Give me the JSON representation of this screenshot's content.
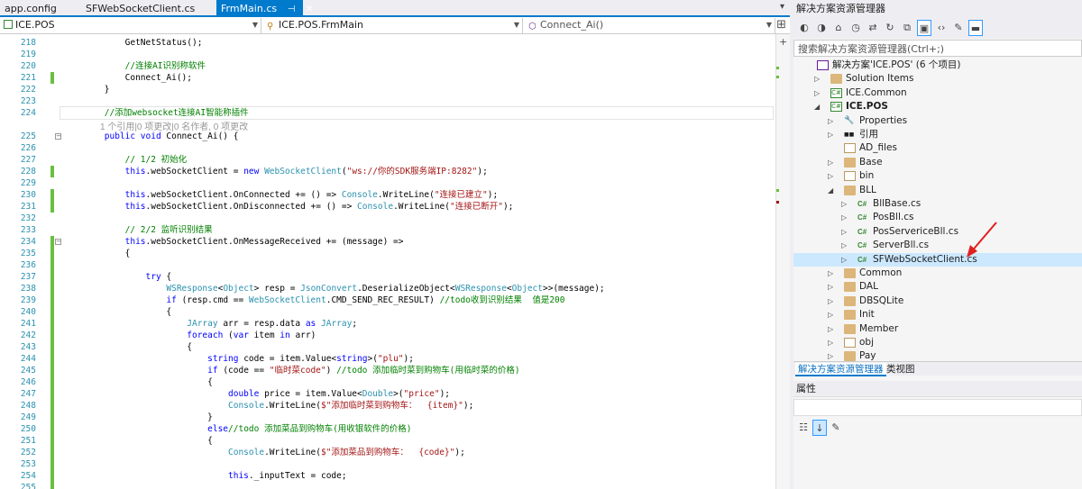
{
  "tabs": {
    "items": [
      {
        "label": "app.config"
      },
      {
        "label": "SFWebSocketClient.cs"
      },
      {
        "label": "FrmMain.cs",
        "active": true
      }
    ],
    "pin_icon": "pin-icon",
    "close_glyph": "✕",
    "dropdown_glyph": "▾"
  },
  "navbar": {
    "project": "ICE.POS",
    "class_name": "ICE.POS.FrmMain",
    "member": "Connect_Ai()"
  },
  "editor": {
    "codelens": "1 个引用|0 项更改|0 名作者, 0 项更改",
    "lines": [
      {
        "n": "218",
        "code": [
          [
            "pl",
            "            GetNetStatus();"
          ]
        ]
      },
      {
        "n": "219",
        "code": []
      },
      {
        "n": "220",
        "code": [
          [
            "cm",
            "            //连接AI识别称软件"
          ]
        ]
      },
      {
        "n": "221",
        "code": [
          [
            "pl",
            "            Connect_Ai();"
          ]
        ]
      },
      {
        "n": "222",
        "code": [
          [
            "pl",
            "        }"
          ]
        ]
      },
      {
        "n": "223",
        "code": []
      },
      {
        "n": "224",
        "code": [
          [
            "cm",
            "        //添加websocket连接AI智能称插件"
          ]
        ]
      },
      {
        "n": "225",
        "code": [
          [
            "kw",
            "        public void "
          ],
          [
            "pl",
            "Connect_Ai() {"
          ]
        ]
      },
      {
        "n": "226",
        "code": []
      },
      {
        "n": "227",
        "code": [
          [
            "cm",
            "            // 1/2 初始化"
          ]
        ]
      },
      {
        "n": "228",
        "code": [
          [
            "kw",
            "            this"
          ],
          [
            "pl",
            ".webSocketClient = "
          ],
          [
            "kw",
            "new "
          ],
          [
            "ty",
            "WebSocketClient"
          ],
          [
            "pl",
            "("
          ],
          [
            "st",
            "\"ws://你的SDK服务端IP:8282\""
          ],
          [
            "pl",
            ");"
          ]
        ]
      },
      {
        "n": "229",
        "code": []
      },
      {
        "n": "230",
        "code": [
          [
            "kw",
            "            this"
          ],
          [
            "pl",
            ".webSocketClient.OnConnected += () => "
          ],
          [
            "ty",
            "Console"
          ],
          [
            "pl",
            ".WriteLine("
          ],
          [
            "st",
            "\"连接已建立\""
          ],
          [
            "pl",
            ");"
          ]
        ]
      },
      {
        "n": "231",
        "code": [
          [
            "kw",
            "            this"
          ],
          [
            "pl",
            ".webSocketClient.OnDisconnected += () => "
          ],
          [
            "ty",
            "Console"
          ],
          [
            "pl",
            ".WriteLine("
          ],
          [
            "st",
            "\"连接已断开\""
          ],
          [
            "pl",
            ");"
          ]
        ]
      },
      {
        "n": "232",
        "code": []
      },
      {
        "n": "233",
        "code": [
          [
            "cm",
            "            // 2/2 监听识别结果"
          ]
        ]
      },
      {
        "n": "234",
        "code": [
          [
            "kw",
            "            this"
          ],
          [
            "pl",
            ".webSocketClient.OnMessageReceived += (message) =>"
          ]
        ]
      },
      {
        "n": "235",
        "code": [
          [
            "pl",
            "            {"
          ]
        ]
      },
      {
        "n": "236",
        "code": []
      },
      {
        "n": "237",
        "code": [
          [
            "kw",
            "                try "
          ],
          [
            "pl",
            "{"
          ]
        ]
      },
      {
        "n": "238",
        "code": [
          [
            "ty",
            "                    WSResponse"
          ],
          [
            "pl",
            "<"
          ],
          [
            "ty",
            "Object"
          ],
          [
            "pl",
            "> resp = "
          ],
          [
            "ty",
            "JsonConvert"
          ],
          [
            "pl",
            ".DeserializeObject<"
          ],
          [
            "ty",
            "WSResponse"
          ],
          [
            "pl",
            "<"
          ],
          [
            "ty",
            "Object"
          ],
          [
            "pl",
            ">>(message);"
          ]
        ]
      },
      {
        "n": "239",
        "code": [
          [
            "kw",
            "                    if "
          ],
          [
            "pl",
            "(resp.cmd == "
          ],
          [
            "ty",
            "WebSocketClient"
          ],
          [
            "pl",
            ".CMD_SEND_REC_RESULT) "
          ],
          [
            "cm",
            "//todo收到识别结果  值是200"
          ]
        ]
      },
      {
        "n": "240",
        "code": [
          [
            "pl",
            "                    {"
          ]
        ]
      },
      {
        "n": "241",
        "code": [
          [
            "ty",
            "                        JArray "
          ],
          [
            "pl",
            "arr = resp.data "
          ],
          [
            "kw",
            "as "
          ],
          [
            "ty",
            "JArray"
          ],
          [
            "pl",
            ";"
          ]
        ]
      },
      {
        "n": "242",
        "code": [
          [
            "kw",
            "                        foreach "
          ],
          [
            "pl",
            "("
          ],
          [
            "kw",
            "var "
          ],
          [
            "pl",
            "item "
          ],
          [
            "kw",
            "in "
          ],
          [
            "pl",
            "arr)"
          ]
        ]
      },
      {
        "n": "243",
        "code": [
          [
            "pl",
            "                        {"
          ]
        ]
      },
      {
        "n": "244",
        "code": [
          [
            "kw",
            "                            string "
          ],
          [
            "pl",
            "code = item.Value<"
          ],
          [
            "kw",
            "string"
          ],
          [
            "pl",
            ">("
          ],
          [
            "st",
            "\"plu\""
          ],
          [
            "pl",
            ");"
          ]
        ]
      },
      {
        "n": "245",
        "code": [
          [
            "kw",
            "                            if "
          ],
          [
            "pl",
            "(code == "
          ],
          [
            "st",
            "\"临时菜code\""
          ],
          [
            "pl",
            ") "
          ],
          [
            "cm",
            "//todo 添加临时菜到购物车(用临时菜的价格)"
          ]
        ]
      },
      {
        "n": "246",
        "code": [
          [
            "pl",
            "                            {"
          ]
        ]
      },
      {
        "n": "247",
        "code": [
          [
            "kw",
            "                                double "
          ],
          [
            "pl",
            "price = item.Value<"
          ],
          [
            "ty",
            "Double"
          ],
          [
            "pl",
            ">("
          ],
          [
            "st",
            "\"price\""
          ],
          [
            "pl",
            ");"
          ]
        ]
      },
      {
        "n": "248",
        "code": [
          [
            "ty",
            "                                Console"
          ],
          [
            "pl",
            ".WriteLine("
          ],
          [
            "st",
            "$\"添加临时菜到购物车：  {item}\""
          ],
          [
            "pl",
            ");"
          ]
        ]
      },
      {
        "n": "249",
        "code": [
          [
            "pl",
            "                            }"
          ]
        ]
      },
      {
        "n": "250",
        "code": [
          [
            "kw",
            "                            else"
          ],
          [
            "cm",
            "//todo 添加菜品到购物车(用收银软件的价格)"
          ]
        ]
      },
      {
        "n": "251",
        "code": [
          [
            "pl",
            "                            {"
          ]
        ]
      },
      {
        "n": "252",
        "code": [
          [
            "ty",
            "                                Console"
          ],
          [
            "pl",
            ".WriteLine("
          ],
          [
            "st",
            "$\"添加菜品到购物车：  {code}\""
          ],
          [
            "pl",
            ");"
          ]
        ]
      },
      {
        "n": "253",
        "code": []
      },
      {
        "n": "254",
        "code": [
          [
            "kw",
            "                                this"
          ],
          [
            "pl",
            "._inputText = code;"
          ]
        ]
      },
      {
        "n": "255",
        "code": []
      }
    ]
  },
  "solution": {
    "title": "解决方案资源管理器",
    "search_placeholder": "搜索解决方案资源管理器(Ctrl+;)",
    "toolbar_icons": [
      "back-icon",
      "forward-icon",
      "home-icon",
      "history-icon",
      "sync-icon",
      "refresh-icon",
      "collapse-all-icon",
      "show-all-files-icon",
      "code-view-icon",
      "properties-wrench-icon",
      "preview-icon"
    ],
    "tree": [
      {
        "label": "解决方案'ICE.POS' (6 个项目)",
        "icon": "solution-icon",
        "exp": "",
        "depth": 0
      },
      {
        "label": "Solution Items",
        "icon": "folder-icon",
        "exp": "▷",
        "depth": 1
      },
      {
        "label": "ICE.Common",
        "icon": "csproj-icon",
        "exp": "▷",
        "depth": 1
      },
      {
        "label": "ICE.POS",
        "icon": "csproj-icon",
        "exp": "◢",
        "depth": 1,
        "bold": true
      },
      {
        "label": "Properties",
        "icon": "wrench-icon",
        "exp": "▷",
        "depth": 2
      },
      {
        "label": "引用",
        "icon": "references-icon",
        "exp": "▷",
        "depth": 2
      },
      {
        "label": "AD_files",
        "icon": "empty-folder-icon",
        "exp": "",
        "depth": 2
      },
      {
        "label": "Base",
        "icon": "folder-icon",
        "exp": "▷",
        "depth": 2
      },
      {
        "label": "bin",
        "icon": "empty-folder-icon",
        "exp": "▷",
        "depth": 2
      },
      {
        "label": "BLL",
        "icon": "folder-icon",
        "exp": "◢",
        "depth": 2
      },
      {
        "label": "BllBase.cs",
        "icon": "csharp-file-icon",
        "exp": "▷",
        "depth": 3
      },
      {
        "label": "PosBll.cs",
        "icon": "csharp-file-icon",
        "exp": "▷",
        "depth": 3
      },
      {
        "label": "PosServericeBll.cs",
        "icon": "csharp-file-icon",
        "exp": "▷",
        "depth": 3
      },
      {
        "label": "ServerBll.cs",
        "icon": "csharp-file-icon",
        "exp": "▷",
        "depth": 3
      },
      {
        "label": "SFWebSocketClient.cs",
        "icon": "csharp-file-icon",
        "exp": "▷",
        "depth": 3,
        "selected": true
      },
      {
        "label": "Common",
        "icon": "folder-icon",
        "exp": "▷",
        "depth": 2
      },
      {
        "label": "DAL",
        "icon": "folder-icon",
        "exp": "▷",
        "depth": 2
      },
      {
        "label": "DBSQLite",
        "icon": "folder-icon",
        "exp": "▷",
        "depth": 2
      },
      {
        "label": "Init",
        "icon": "folder-icon",
        "exp": "▷",
        "depth": 2
      },
      {
        "label": "Member",
        "icon": "folder-icon",
        "exp": "▷",
        "depth": 2
      },
      {
        "label": "obj",
        "icon": "empty-folder-icon",
        "exp": "▷",
        "depth": 2
      },
      {
        "label": "Pay",
        "icon": "folder-icon",
        "exp": "▷",
        "depth": 2
      }
    ],
    "bottom_tabs": [
      {
        "label": "解决方案资源管理器",
        "active": true
      },
      {
        "label": "类视图"
      }
    ]
  },
  "properties": {
    "title": "属性",
    "tool_icons": [
      "categorized-icon",
      "alphabetical-icon",
      "property-pages-icon"
    ]
  },
  "colors": {
    "accent": "#007acc",
    "keyword": "#0000ff",
    "type": "#2b91af",
    "string": "#a31515",
    "comment": "#008000",
    "change_bar": "#6abf40",
    "arrow": "#e02020"
  }
}
